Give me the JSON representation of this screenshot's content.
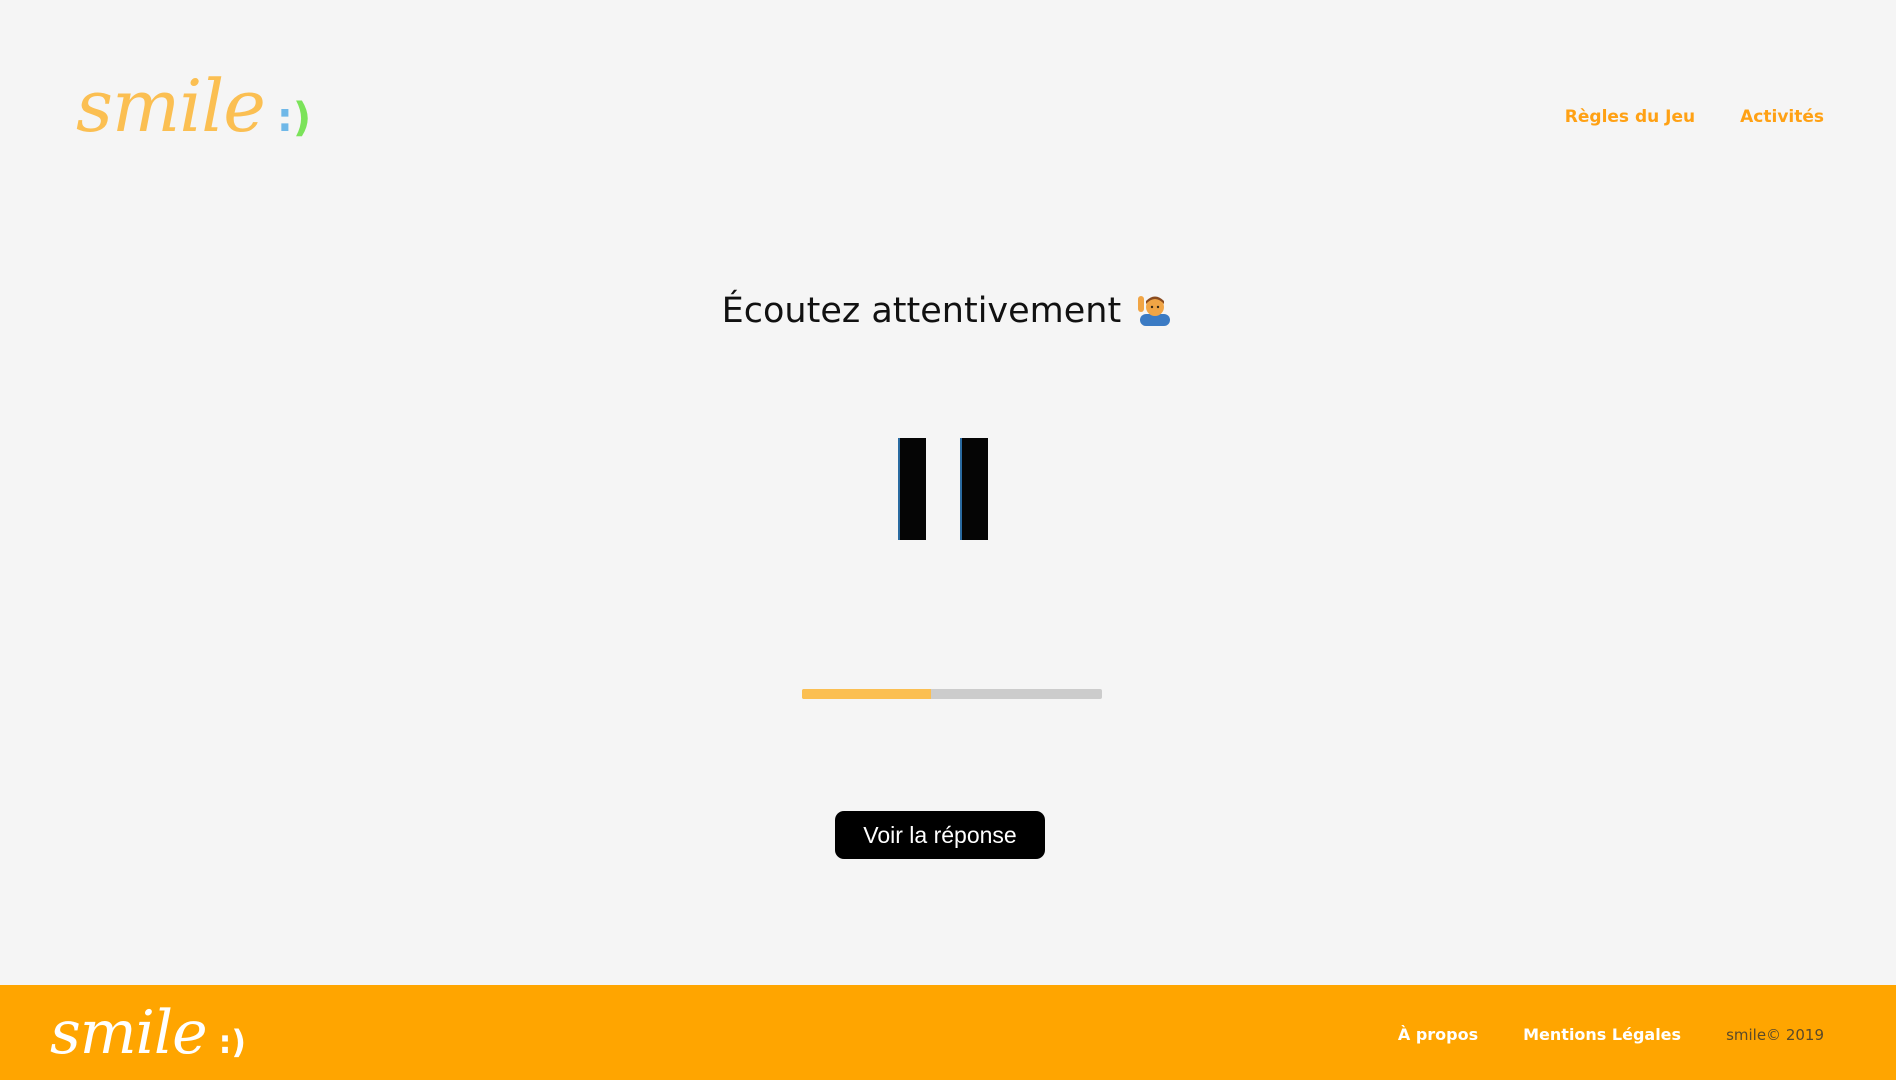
{
  "header": {
    "logo_text": "smile",
    "logo_face": [
      ":",
      ")"
    ],
    "nav": [
      {
        "label": "Règles du Jeu"
      },
      {
        "label": "Activités"
      }
    ]
  },
  "main": {
    "title": "Écoutez attentivement",
    "title_emoji_icon": "person-raising-hand-emoji",
    "player_state": "playing",
    "progress_fraction": 0.43,
    "answer_button_label": "Voir la réponse"
  },
  "footer": {
    "logo_text": "smile",
    "logo_face": [
      ":",
      ")"
    ],
    "links": [
      {
        "label": "À propos"
      },
      {
        "label": "Mentions Légales"
      }
    ],
    "copyright": "smile© 2019"
  },
  "colors": {
    "accent": "#ffa500",
    "logo": "#fbbf52",
    "background": "#f5f5f5",
    "progress_fill": "#fbbf52",
    "progress_track": "#cccccc"
  }
}
